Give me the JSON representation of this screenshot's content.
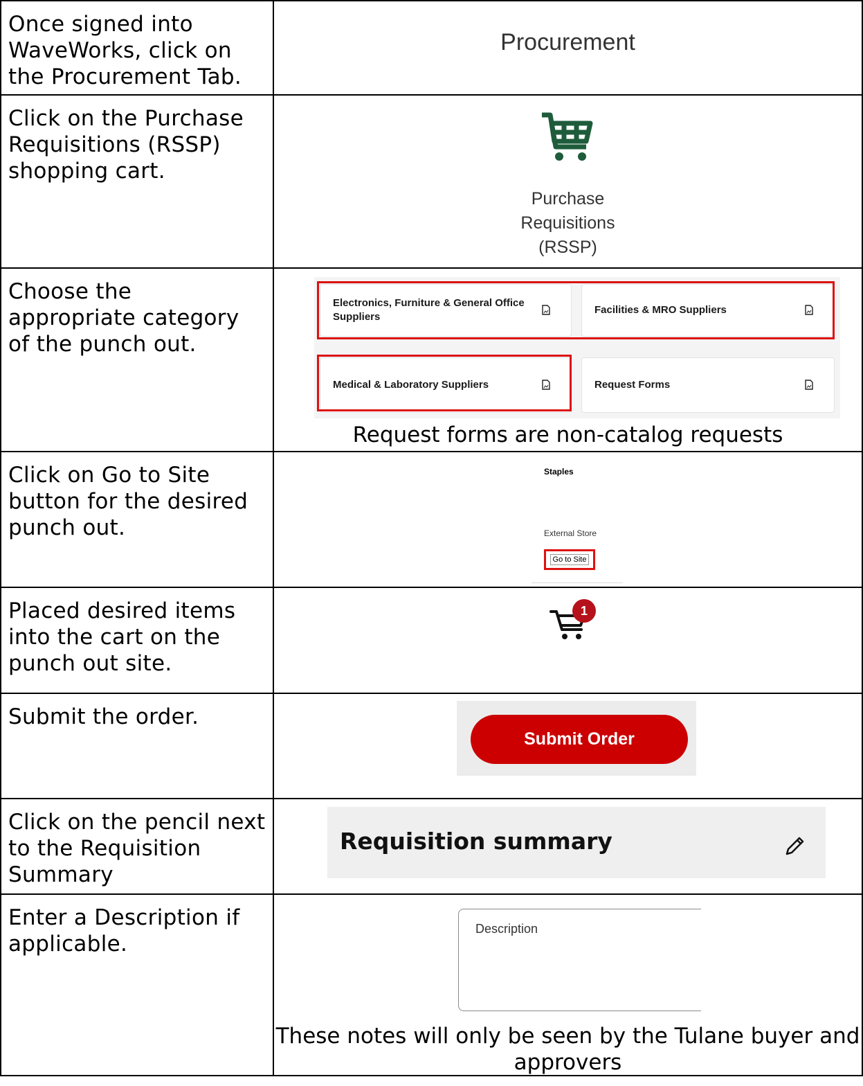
{
  "steps": [
    {
      "instruction": "Once signed into WaveWorks, click on the Procurement Tab.",
      "ui_label": "Procurement"
    },
    {
      "instruction": "Click on the Purchase Requisitions (RSSP) shopping cart.",
      "ui_label_lines": [
        "Purchase",
        "Requisitions",
        "(RSSP)"
      ],
      "icon_color": "#1e5c3b"
    },
    {
      "instruction": "Choose the appropriate category of the punch out.",
      "categories": [
        "Electronics, Furniture & General Office Suppliers",
        "Facilities & MRO Suppliers",
        "Medical & Laboratory Suppliers",
        "Request Forms"
      ],
      "note": "Request forms are non-catalog requests"
    },
    {
      "instruction": "Click on Go to Site button for the desired punch out.",
      "store_name": "Staples",
      "store_type": "External Store",
      "button_label": "Go to Site"
    },
    {
      "instruction": "Placed desired items into the cart on the punch out site.",
      "cart_count": "1"
    },
    {
      "instruction": "Submit the order.",
      "button_label": "Submit Order"
    },
    {
      "instruction": "Click on the pencil next to the Requisition Summary",
      "panel_title": "Requisition summary"
    },
    {
      "instruction": "Enter a Description if applicable.",
      "field_label": "Description",
      "note": "These notes will only be seen by the Tulane buyer and approvers"
    }
  ],
  "colors": {
    "highlight": "#dd1111",
    "brand_red": "#cc0000",
    "badge": "#b5121b",
    "cart_green": "#1e5c3b"
  }
}
